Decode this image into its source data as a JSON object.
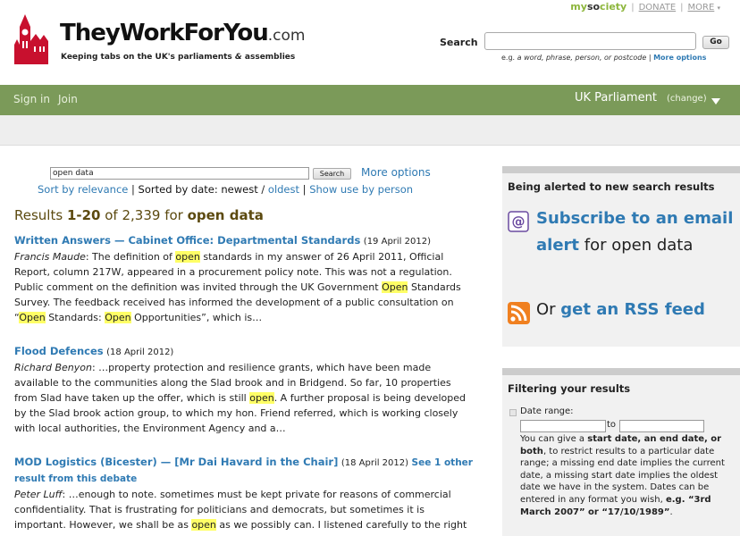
{
  "top_links": {
    "brand_my": "my",
    "brand_so": "so",
    "brand_ciety": "ciety",
    "donate": "DONATE",
    "more": "MORE"
  },
  "logo": {
    "name": "TheyWorkForYou",
    "domain": ".com",
    "tagline_part1": "Keeping tabs on the UK's parliaments ",
    "tagline_amp": "&",
    "tagline_part2": " assemblies"
  },
  "header_search": {
    "label": "Search",
    "placeholder": "",
    "go": "Go",
    "hint_prefix": "e.g. ",
    "hint_examples": "a word, phrase, person, or postcode",
    "hint_sep": " | ",
    "more_options": "More options"
  },
  "nav": {
    "sign_in": "Sign in",
    "join": "Join",
    "parliament": "UK Parliament",
    "change": "(change)"
  },
  "search": {
    "query": "open data",
    "button": "Search",
    "more_options": "More options"
  },
  "sort": {
    "by_relevance": "Sort by relevance",
    "sep1": " | ",
    "sorted_by_date": "Sorted by date: newest",
    "slash": " / ",
    "oldest": "oldest",
    "sep2": " | ",
    "by_person": "Show use by person"
  },
  "results_summary": {
    "prefix": "Results ",
    "range": "1-20",
    "of": " of 2,339 for ",
    "term": "open data"
  },
  "results": [
    {
      "title": "Written Answers — Cabinet Office: Departmental Standards",
      "date": "(19 April 2012)",
      "speaker": "Francis Maude",
      "segments": [
        ": The definition of ",
        "open",
        " standards in my answer of 26 April 2011, Official Report, column 217W, appeared in a procurement policy note. This was not a regulation. Public comment on the definition was invited through the UK Government ",
        "Open",
        " Standards Survey. The feedback received has informed the development of a public consultation on “",
        "Open",
        " Standards: ",
        "Open",
        " Opportunities”, which is…"
      ]
    },
    {
      "title": "Flood Defences",
      "date": "(18 April 2012)",
      "speaker": "Richard Benyon",
      "segments": [
        ": …property protection and resilience grants, which have been made available to the communities along the Slad brook and in Bridgend. So far, 10 properties from Slad have taken up the offer, which is still ",
        "open",
        ". A further proposal is being developed by the Slad brook action group, to which my hon. Friend referred, which is working closely with local authorities, the Environment Agency and a…"
      ]
    },
    {
      "title": "MOD Logistics (Bicester) — [Mr Dai Havard in the Chair]",
      "date": "(18 April 2012)",
      "more": "See 1 other result from this debate",
      "speaker": "Peter Luff",
      "segments": [
        ": …enough to note. sometimes must be kept private for reasons of commercial confidentiality. That is frustrating for politicians and democrats, but sometimes it is important. However, we shall be as ",
        "open",
        " as we possibly can. I listened carefully to the right hon. Member for Derby Moldy and heard him raise several points…"
      ]
    }
  ],
  "sidebar": {
    "alert_heading": "Being alerted to new search results",
    "alert_link": "Subscribe to an email alert",
    "alert_suffix": " for open data",
    "rss_prefix": "Or ",
    "rss_link": "get an RSS feed",
    "filter_heading": "Filtering your results",
    "date_range_label": "Date range:",
    "to": "to",
    "help": {
      "t1": "You can give a ",
      "b1": "start date, an end date, or both",
      "t2": ", to restrict results to a particular date range; a missing end date implies the current date, a missing start date implies the oldest date we have in the system. Dates can be entered in any format you wish, ",
      "b2": "e.g. “3rd March 2007” or “17/10/1989”",
      "t3": "."
    }
  },
  "colors": {
    "nav_green": "#7b9a59",
    "link_blue": "#2f7ab3",
    "highlight": "#ffff66",
    "rss_orange": "#f08020",
    "results_brown": "#5c4a10"
  }
}
